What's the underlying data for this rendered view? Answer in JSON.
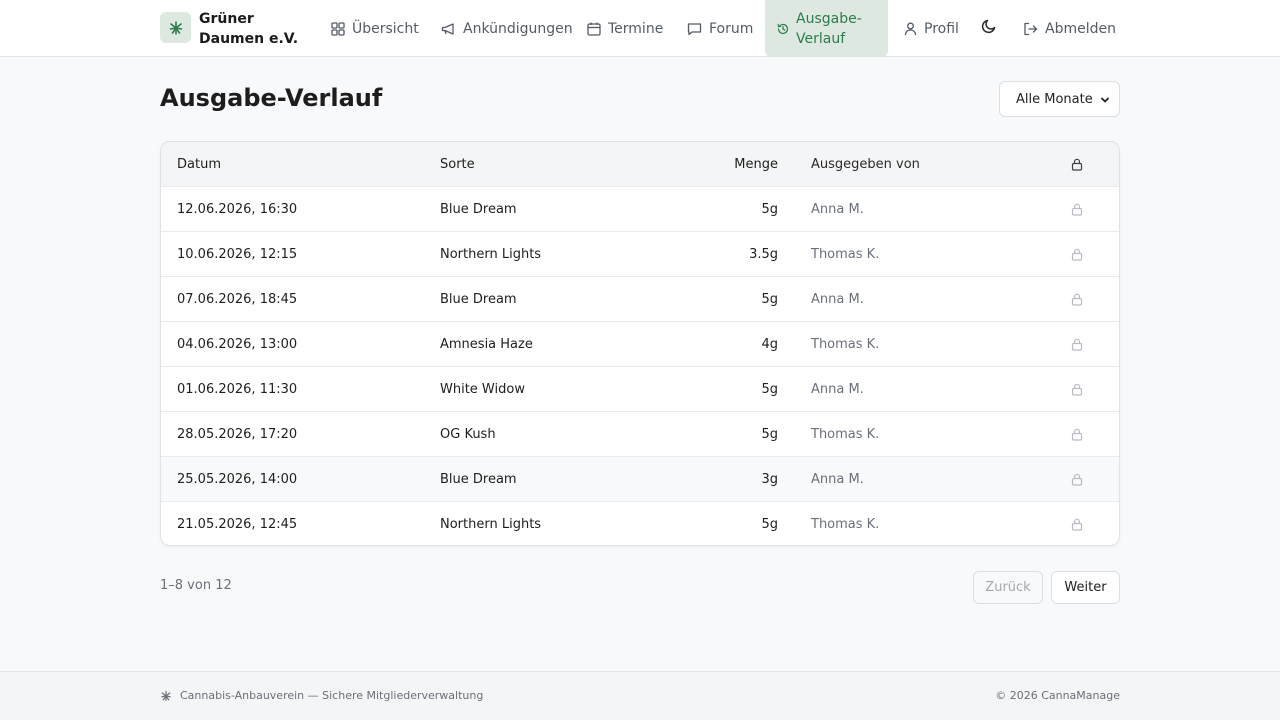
{
  "brand": {
    "name": "Grüner Daumen e.V.",
    "logo_icon": "cannabis-leaf-icon"
  },
  "nav": {
    "items": [
      {
        "label": "Übersicht",
        "icon": "dashboard-icon",
        "active": false
      },
      {
        "label": "Ankündigungen",
        "icon": "megaphone-icon",
        "active": false
      },
      {
        "label": "Termine",
        "icon": "calendar-icon",
        "active": false
      },
      {
        "label": "Forum",
        "icon": "chat-bubble-icon",
        "active": false
      },
      {
        "label": "Ausgabe-Verlauf",
        "icon": "history-icon",
        "active": true
      },
      {
        "label": "Profil",
        "icon": "user-icon",
        "active": false
      },
      {
        "label": "Abmelden",
        "icon": "logout-icon",
        "active": false
      }
    ],
    "theme_toggle_icon": "moon-icon"
  },
  "page": {
    "title": "Ausgabe-Verlauf",
    "month_filter": {
      "selected": "Alle Monate"
    }
  },
  "table": {
    "columns": [
      "Datum",
      "Sorte",
      "Menge",
      "Ausgegeben von"
    ],
    "lock_icon": "lock-icon",
    "rows": [
      {
        "date": "12.06.2026, 16:30",
        "sorte": "Blue Dream",
        "menge": "5g",
        "by": "Anna M."
      },
      {
        "date": "10.06.2026, 12:15",
        "sorte": "Northern Lights",
        "menge": "3.5g",
        "by": "Thomas K."
      },
      {
        "date": "07.06.2026, 18:45",
        "sorte": "Blue Dream",
        "menge": "5g",
        "by": "Anna M."
      },
      {
        "date": "04.06.2026, 13:00",
        "sorte": "Amnesia Haze",
        "menge": "4g",
        "by": "Thomas K."
      },
      {
        "date": "01.06.2026, 11:30",
        "sorte": "White Widow",
        "menge": "5g",
        "by": "Anna M."
      },
      {
        "date": "28.05.2026, 17:20",
        "sorte": "OG Kush",
        "menge": "5g",
        "by": "Thomas K."
      },
      {
        "date": "25.05.2026, 14:00",
        "sorte": "Blue Dream",
        "menge": "3g",
        "by": "Anna M."
      },
      {
        "date": "21.05.2026, 12:45",
        "sorte": "Northern Lights",
        "menge": "5g",
        "by": "Thomas K."
      }
    ]
  },
  "pagination": {
    "summary": "1–8 von 12",
    "prev_label": "Zurück",
    "next_label": "Weiter"
  },
  "footer": {
    "left": "Cannabis-Anbauverein — Sichere Mitgliederverwaltung",
    "right": "© 2026 CannaManage"
  },
  "colors": {
    "accent": "#2e7b4b",
    "accent_bg": "#dde9e0",
    "muted": "#6a7079"
  }
}
